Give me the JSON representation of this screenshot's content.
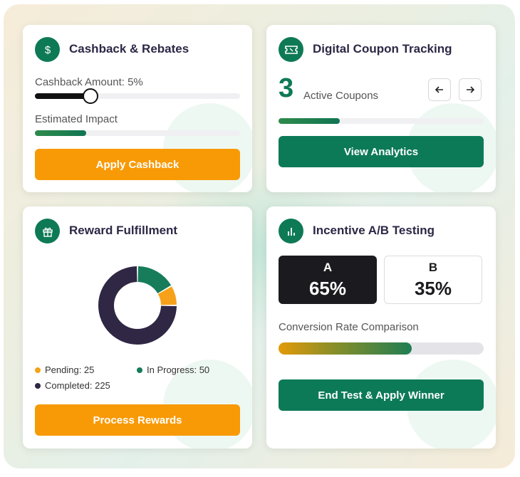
{
  "cashback": {
    "title": "Cashback & Rebates",
    "icon": "dollar-icon",
    "amount_label": "Cashback Amount: 5%",
    "slider_value": 0.27,
    "impact_label": "Estimated Impact",
    "impact_value": 0.25,
    "button": "Apply Cashback"
  },
  "coupons": {
    "title": "Digital Coupon Tracking",
    "icon": "ticket-icon",
    "count": "3",
    "count_label": "Active Coupons",
    "progress_value": 0.3,
    "button": "View Analytics"
  },
  "rewards": {
    "title": "Reward Fulfillment",
    "icon": "gift-icon",
    "chart_data": {
      "type": "pie",
      "categories": [
        "Pending",
        "In Progress",
        "Completed"
      ],
      "values": [
        25,
        50,
        225
      ],
      "colors": [
        "#f7a11a",
        "#167c59",
        "#2f2744"
      ]
    },
    "legend": {
      "pending": "Pending: 25",
      "in_progress": "In Progress: 50",
      "completed": "Completed: 225"
    },
    "button": "Process Rewards"
  },
  "abtest": {
    "title": "Incentive A/B Testing",
    "icon": "bar-chart-icon",
    "variant_a": {
      "name": "A",
      "value": "65%"
    },
    "variant_b": {
      "name": "B",
      "value": "35%"
    },
    "comparison_label": "Conversion Rate Comparison",
    "comparison_value": 0.65,
    "button": "End Test & Apply Winner"
  },
  "colors": {
    "accent_green": "#0d7a57",
    "accent_orange": "#f89a06",
    "dark": "#2f2744"
  }
}
